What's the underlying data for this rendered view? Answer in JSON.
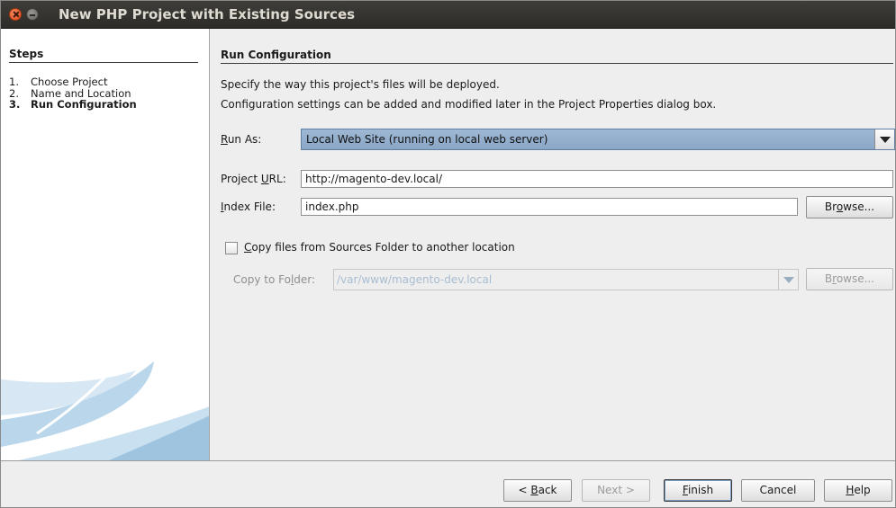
{
  "window": {
    "title": "New PHP Project with Existing Sources"
  },
  "steps": {
    "heading": "Steps",
    "items": [
      {
        "num": "1.",
        "label": "Choose Project",
        "active": false
      },
      {
        "num": "2.",
        "label": "Name and Location",
        "active": false
      },
      {
        "num": "3.",
        "label": "Run Configuration",
        "active": true
      }
    ]
  },
  "content": {
    "title": "Run Configuration",
    "desc_line1": "Specify the way this project's files will be deployed.",
    "desc_line2": "Configuration settings can be added and modified later in the Project Properties dialog box.",
    "run_as": {
      "label_mn": "R",
      "label_rest": "un As:",
      "value": "Local Web Site (running on local web server)"
    },
    "project_url": {
      "label_pre": "Project ",
      "label_mn": "U",
      "label_rest": "RL:",
      "value": "http://magento-dev.local/"
    },
    "index_file": {
      "label_mn": "I",
      "label_rest": "ndex File:",
      "value": "index.php"
    },
    "browse1": {
      "pre": "Br",
      "mn": "o",
      "rest": "wse..."
    },
    "copy_files": {
      "checked": false,
      "label_mn": "C",
      "label_rest": "opy files from Sources Folder to another location"
    },
    "copy_to": {
      "label_pre": "Copy to Fo",
      "label_mn": "l",
      "label_rest": "der:",
      "value": "/var/www/magento-dev.local"
    },
    "browse2": {
      "pre": "B",
      "mn": "r",
      "rest": "owse..."
    }
  },
  "footer": {
    "back": {
      "pre": "< ",
      "mn": "B",
      "rest": "ack"
    },
    "next": "Next >",
    "finish": {
      "mn": "F",
      "rest": "inish"
    },
    "cancel": "Cancel",
    "help": {
      "mn": "H",
      "rest": "elp"
    }
  },
  "colors": {
    "titlebar": "#3e3d39",
    "select_highlight": "#8aa7c6",
    "close_button": "#df4a16"
  }
}
